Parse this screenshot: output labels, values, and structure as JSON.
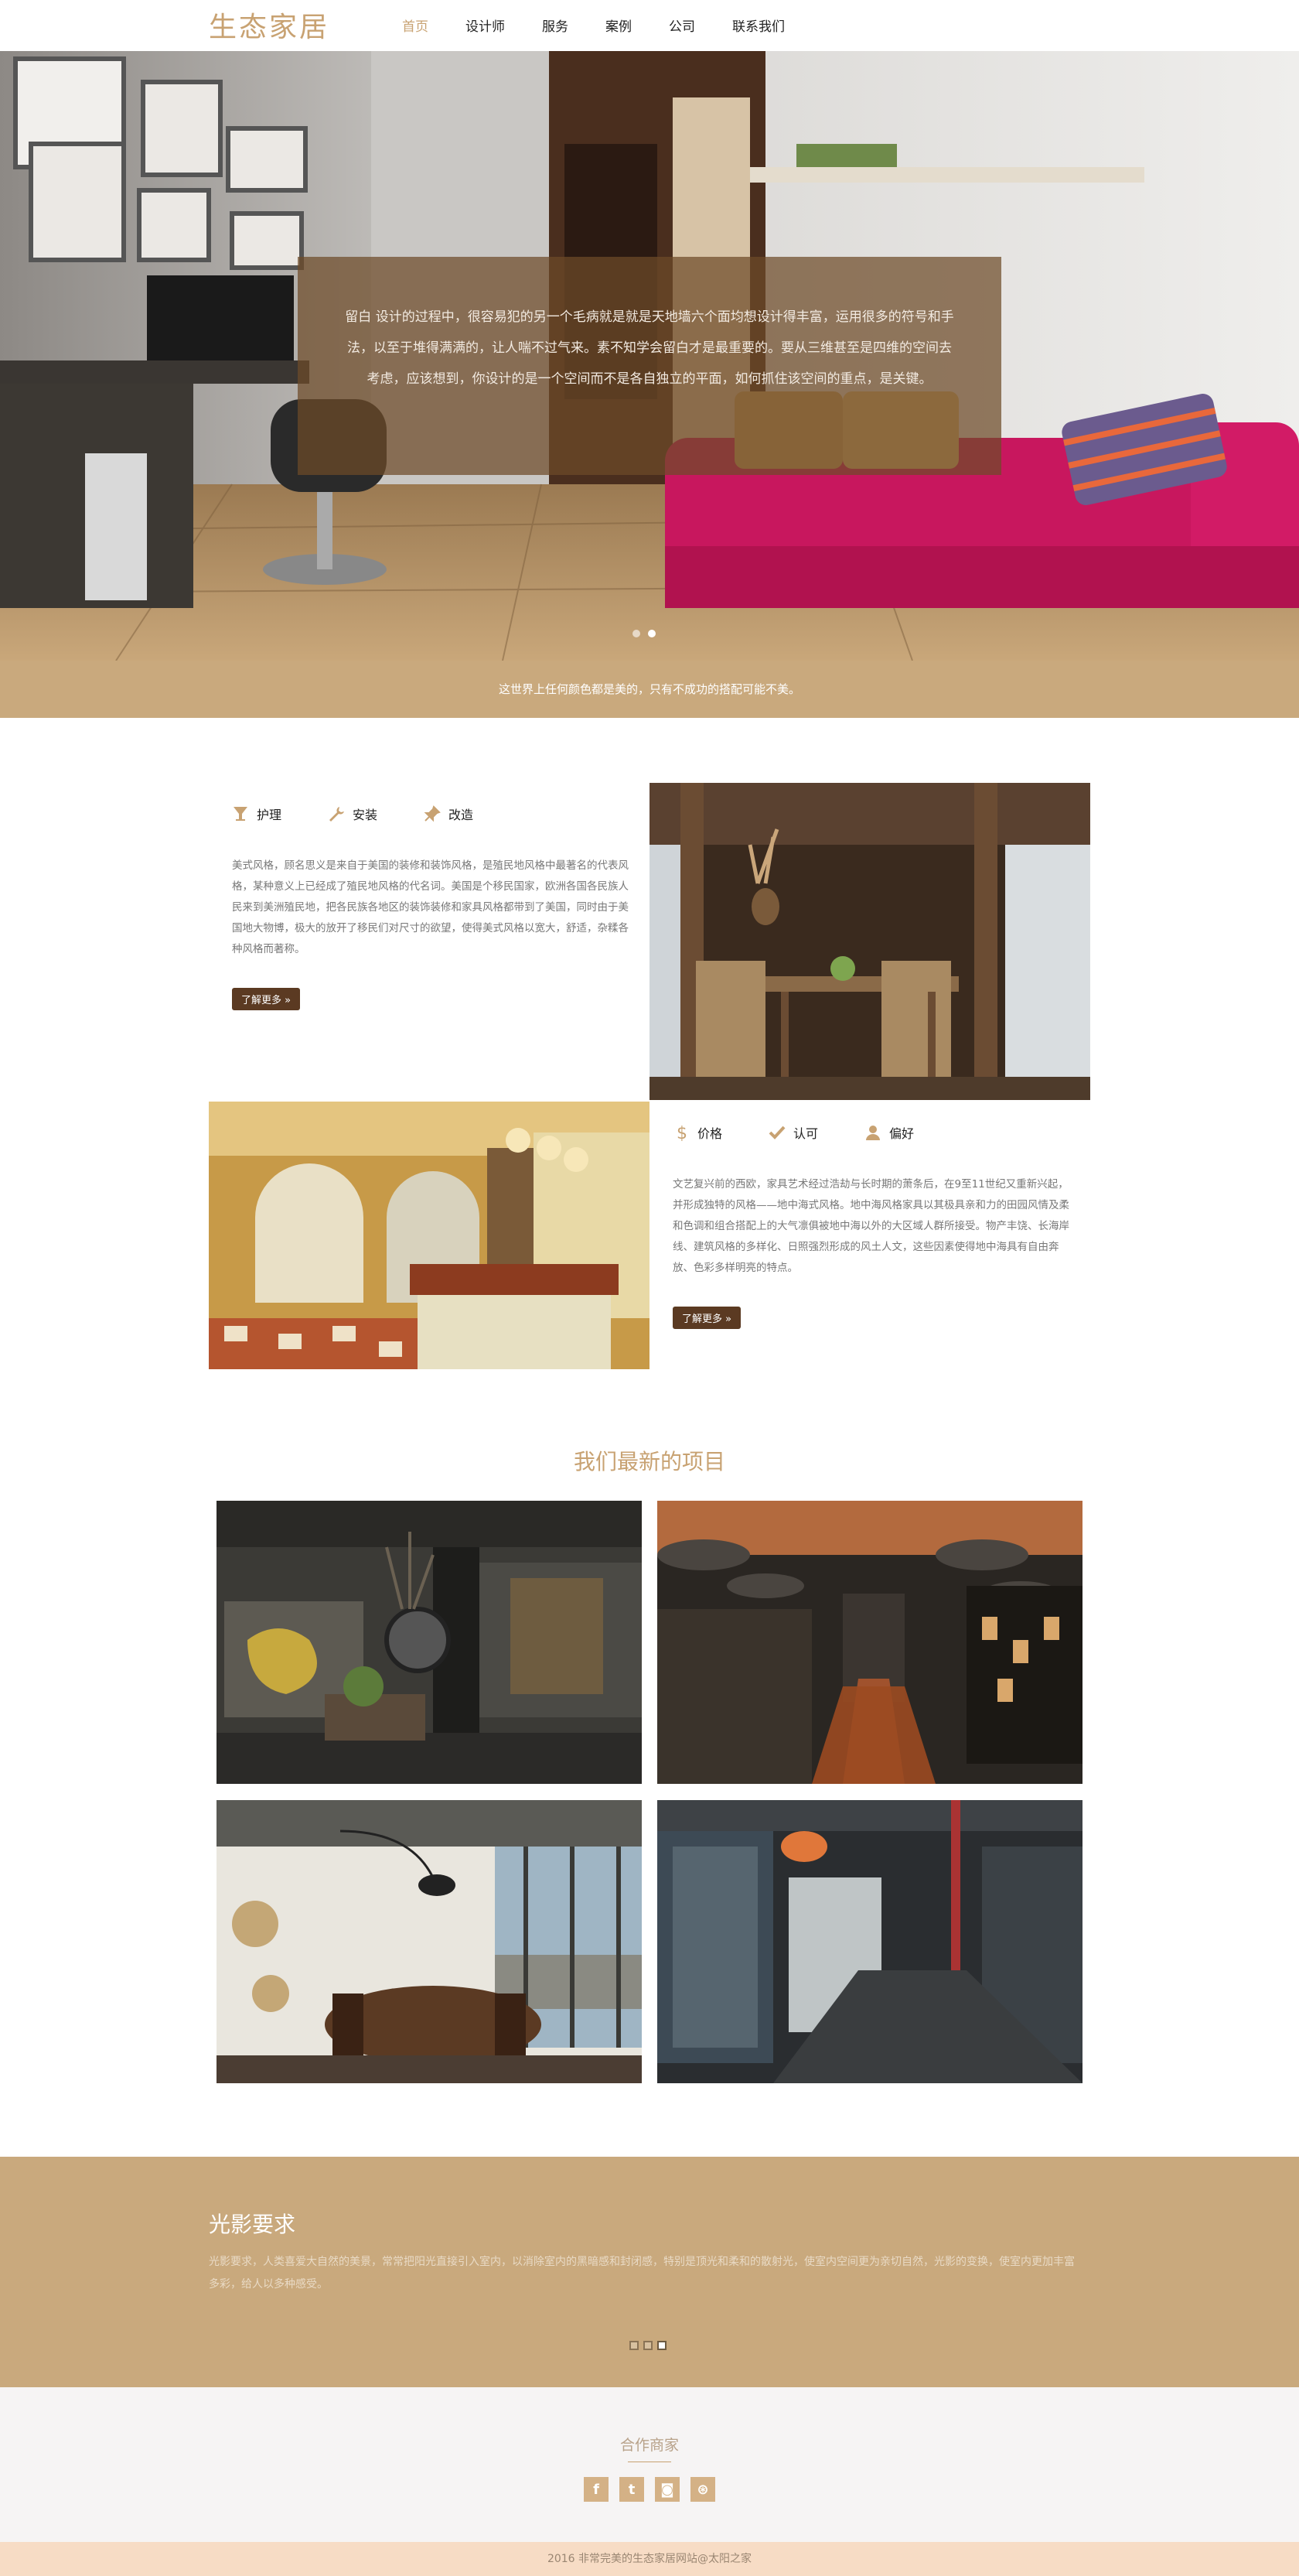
{
  "header": {
    "logo": "生态家居",
    "nav": [
      "首页",
      "设计师",
      "服务",
      "案例",
      "公司",
      "联系我们"
    ]
  },
  "hero": {
    "caption": "留白 设计的过程中，很容易犯的另一个毛病就是就是天地墙六个面均想设计得丰富，运用很多的符号和手法，以至于堆得满满的，让人喘不过气来。素不知学会留白才是最重要的。要从三维甚至是四维的空间去考虑，应该想到，你设计的是一个空间而不是各自独立的平面，如何抓住该空间的重点，是关键。",
    "slide_count": 2,
    "active_slide": 2
  },
  "tagline": "这世界上任何颜色都是美的，只有不成功的搭配可能不美。",
  "feature1": {
    "tabs": [
      {
        "label": "护理",
        "icon": "cup-icon"
      },
      {
        "label": "安装",
        "icon": "wrench-icon"
      },
      {
        "label": "改造",
        "icon": "pin-icon"
      }
    ],
    "text": "美式风格，顾名思义是来自于美国的装修和装饰风格，是殖民地风格中最著名的代表风格，某种意义上已经成了殖民地风格的代名词。美国是个移民国家，欧洲各国各民族人民来到美洲殖民地，把各民族各地区的装饰装修和家具风格都带到了美国，同时由于美国地大物博，极大的放开了移民们对尺寸的欲望，使得美式风格以宽大，舒适，杂糅各种风格而著称。",
    "button": "了解更多"
  },
  "feature2": {
    "tabs": [
      {
        "label": "价格",
        "icon": "dollar-icon"
      },
      {
        "label": "认可",
        "icon": "check-icon"
      },
      {
        "label": "偏好",
        "icon": "user-icon"
      }
    ],
    "text": "文艺复兴前的西欧，家具艺术经过浩劫与长时期的萧条后，在9至11世纪又重新兴起，并形成独特的风格——地中海式风格。地中海风格家具以其极具亲和力的田园风情及柔和色调和组合搭配上的大气凛俱被地中海以外的大区域人群所接受。物产丰饶、长海岸线、建筑风格的多样化、日照强烈形成的风土人文，这些因素使得地中海具有自由奔放、色彩多样明亮的特点。",
    "button": "了解更多"
  },
  "projects": {
    "title": "我们最新的项目"
  },
  "light": {
    "title": "光影要求",
    "text": "光影要求，人类喜爱大自然的美景，常常把阳光直接引入室内，以消除室内的黑暗感和封闭感，特别是顶光和柔和的散射光，使室内空间更为亲切自然，光影的变换，使室内更加丰富多彩，给人以多种感受。",
    "dot_count": 3,
    "active_dot": 3
  },
  "partners": {
    "title": "合作商家",
    "socials": [
      {
        "icon": "facebook-icon",
        "glyph": "f"
      },
      {
        "icon": "twitter-icon",
        "glyph": "t"
      },
      {
        "icon": "instagram-icon",
        "glyph": "◙"
      },
      {
        "icon": "dribbble-icon",
        "glyph": "⊛"
      }
    ]
  },
  "footer": {
    "text": "2016 非常完美的生态家居网站@太阳之家"
  },
  "colors": {
    "accent": "#c8a272",
    "band": "#c9a97d",
    "button": "#5b3a22",
    "footer": "#f7dcc5"
  }
}
